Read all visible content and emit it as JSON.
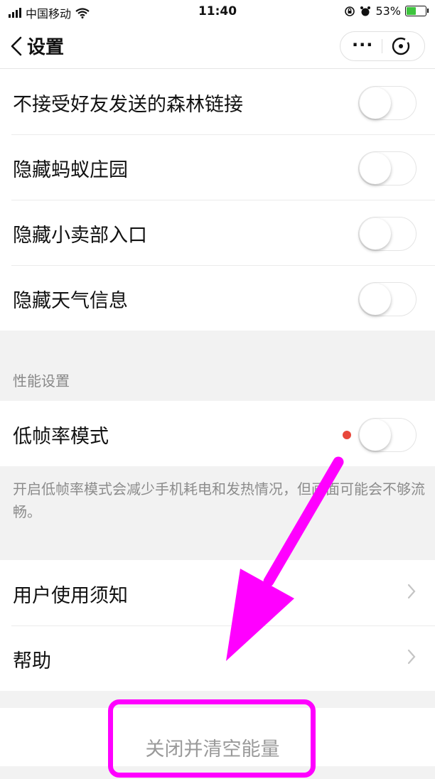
{
  "status_bar": {
    "carrier": "中国移动",
    "time": "11:40",
    "battery_text": "53%",
    "battery_level": 0.53
  },
  "nav": {
    "title": "设置",
    "more_icon": "more-icon",
    "close_icon": "capsule-close-icon"
  },
  "group_one": {
    "items": [
      {
        "label": "不接受好友发送的森林链接",
        "on": false
      },
      {
        "label": "隐藏蚂蚁庄园",
        "on": false
      },
      {
        "label": "隐藏小卖部入口",
        "on": false
      },
      {
        "label": "隐藏天气信息",
        "on": false
      }
    ]
  },
  "performance": {
    "section_title": "性能设置",
    "low_fps_label": "低帧率模式",
    "low_fps_on": false,
    "note": "开启低帧率模式会减少手机耗电和发热情况，但画面可能会不够流畅。"
  },
  "links": {
    "items": [
      {
        "label": "用户使用须知"
      },
      {
        "label": "帮助"
      }
    ]
  },
  "footer": {
    "clear_label": "关闭并清空能量"
  },
  "colors": {
    "highlight": "#ff00ff",
    "dot": "#e8473b",
    "battery": "#3ec43e"
  }
}
